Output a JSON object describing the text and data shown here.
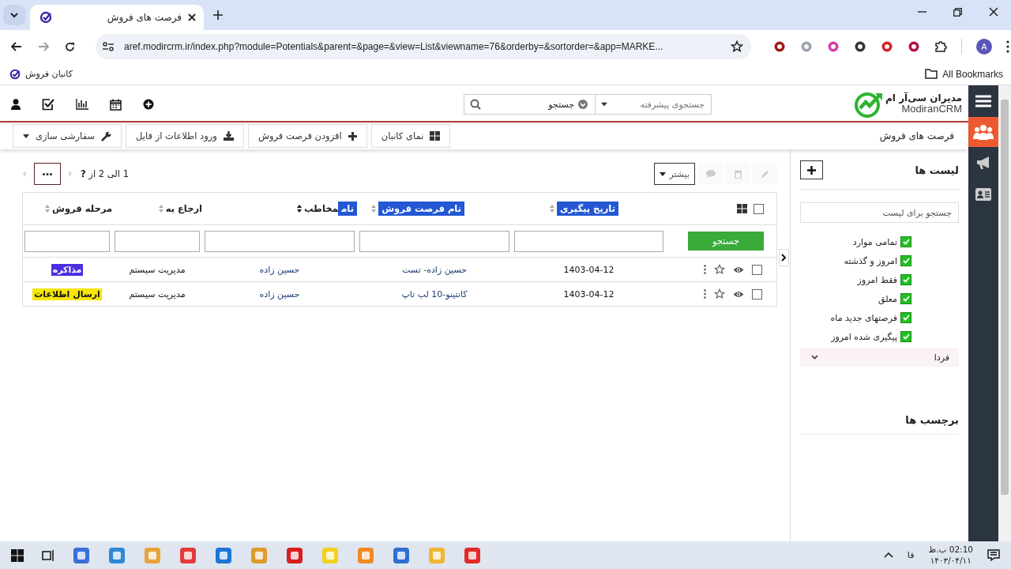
{
  "browser": {
    "tab_title": "فرصت های فروش",
    "url": "aref.modircrm.ir/index.php?module=Potentials&parent=&page=&view=List&viewname=76&orderby=&sortorder=&app=MARKE...",
    "bookmark": "کانبان فروش",
    "all_bookmarks": "All Bookmarks",
    "profile": "A"
  },
  "header": {
    "advanced_placeholder": "جستجوی پیشرفته",
    "search_placeholder": "جستجو",
    "logo_fa": "مدیران سی‌آر ام",
    "logo_en": "ModiranCRM"
  },
  "side_nav": [
    {
      "kind": "people",
      "selected": true
    },
    {
      "kind": "megaphone",
      "selected": false
    },
    {
      "kind": "card",
      "selected": false
    }
  ],
  "module_title": "فرصت های فروش",
  "toolbar": [
    {
      "kind": "grid",
      "label": "نمای کانبان"
    },
    {
      "kind": "plus",
      "label": "افزودن فرصت فروش"
    },
    {
      "kind": "download",
      "label": "ورود اطلاعات از فایل"
    },
    {
      "kind": "wrench",
      "label": "سفارشی سازی"
    }
  ],
  "more_button": "بیشتر",
  "pagination": "1 الی 2  از **?**",
  "columns": [
    {
      "parts": [
        {
          "text": "تاریخ پیگیری",
          "highlighted": true
        }
      ]
    },
    {
      "parts": [
        {
          "text": "نام فرصت فروش",
          "highlighted": true
        }
      ]
    },
    {
      "parts": [
        {
          "text": "نام",
          "highlighted": true
        },
        {
          "text": "مخاطب",
          "highlighted": false
        }
      ]
    },
    {
      "parts": [
        {
          "text": "ارجاع به",
          "highlighted": false
        }
      ]
    },
    {
      "parts": [
        {
          "text": "مرحله فروش",
          "highlighted": false
        }
      ]
    }
  ],
  "search_button": "جستجو",
  "rows": [
    {
      "checked": false,
      "date": "1403-04-12",
      "name": "حسین زاده- تست",
      "contact": "حسین زاده",
      "assigned": "مدیریت سیستم",
      "stage": {
        "label": "مذاکره",
        "color": "#4b2ee0"
      }
    },
    {
      "checked": false,
      "date": "1403-04-12",
      "name": "کانتینو-10 لب تاپ",
      "contact": "حسین زاده",
      "assigned": "مدیریت سیستم",
      "stage": {
        "label": "ارسال اطلاعات",
        "color": "#f5e50a"
      }
    }
  ],
  "all_selected": false,
  "lists": {
    "title": "لیست ها",
    "search_placeholder": "جستجو برای لیست",
    "items": [
      {
        "label": "تمامی موارد",
        "checked": true
      },
      {
        "label": "امروز و گذشته",
        "checked": true
      },
      {
        "label": "فقط امروز",
        "checked": true
      },
      {
        "label": "معلق",
        "checked": true
      },
      {
        "label": "فرصتهای جدید ماه",
        "checked": true
      },
      {
        "label": "پیگیری شده امروز",
        "checked": true
      }
    ],
    "group": {
      "label": "فردا",
      "expanded": false
    }
  },
  "tags_title": "برچسب ها",
  "taskbar": {
    "language": "فا",
    "time": "02:10 ب.ظ",
    "date": "۱۴۰۳/۰۴/۱۱"
  }
}
